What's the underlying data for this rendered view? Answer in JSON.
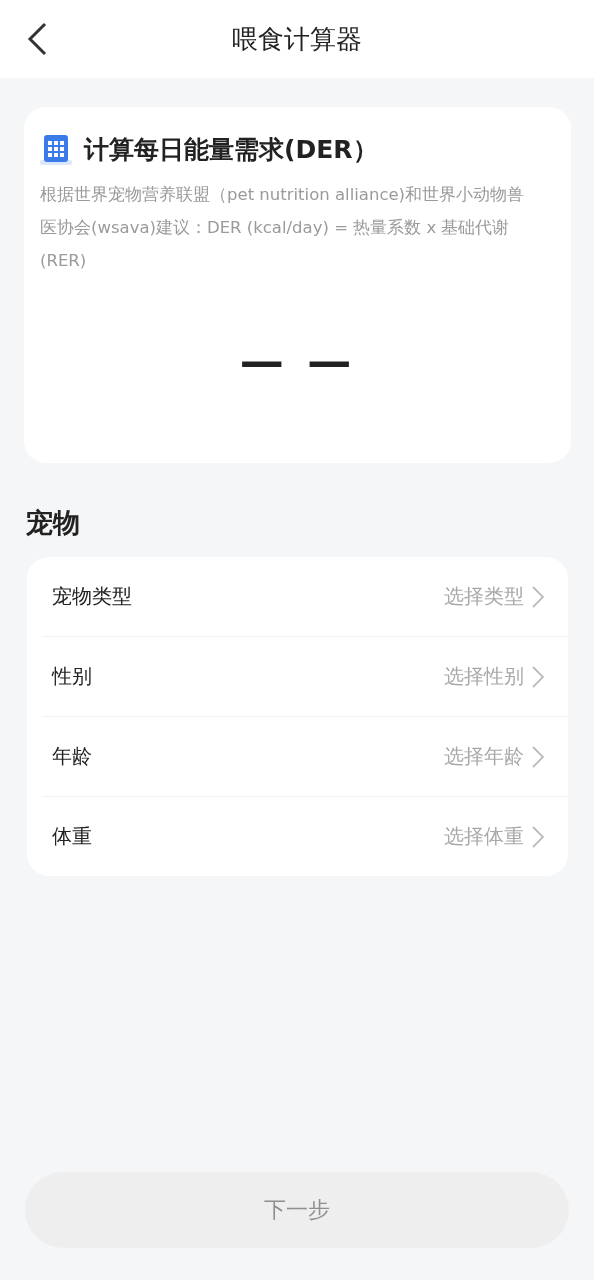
{
  "header": {
    "title": "喂食计算器"
  },
  "result_card": {
    "title": "计算每日能量需求(DER）",
    "description": "根据世界宠物营养联盟（pet nutrition alliance)和世界小动物兽医协会(wsava)建议：DER (kcal/day) = 热量系数 x 基础代谢(RER)",
    "value": "— —"
  },
  "section": {
    "title": "宠物"
  },
  "fields": [
    {
      "label": "宠物类型",
      "placeholder": "选择类型"
    },
    {
      "label": "性别",
      "placeholder": "选择性别"
    },
    {
      "label": "年龄",
      "placeholder": "选择年龄"
    },
    {
      "label": "体重",
      "placeholder": "选择体重"
    }
  ],
  "next_button": {
    "label": "下一步",
    "disabled": true
  }
}
